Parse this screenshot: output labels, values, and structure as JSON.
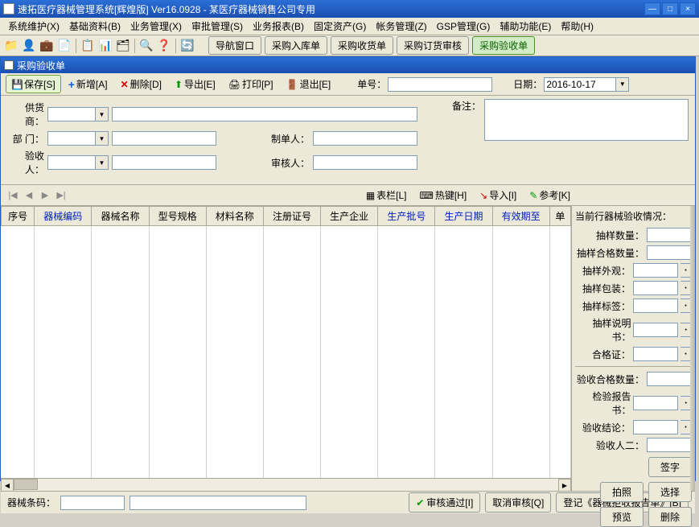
{
  "titlebar": {
    "text": "速拓医疗器械管理系统[辉煌版] Ver16.0928  -  某医疗器械销售公司专用"
  },
  "menubar": {
    "items": [
      "系统维护(X)",
      "基础资料(B)",
      "业务管理(X)",
      "审批管理(S)",
      "业务报表(B)",
      "固定资产(G)",
      "帐务管理(Z)",
      "GSP管理(G)",
      "辅助功能(E)",
      "帮助(H)"
    ]
  },
  "navbtns": {
    "items": [
      "导航窗口",
      "采购入库单",
      "采购收货单",
      "采购订货审核",
      "采购验收单"
    ]
  },
  "subwindow": {
    "title": "采购验收单"
  },
  "actions": {
    "save": "保存[S]",
    "add": "新增[A]",
    "delete": "删除[D]",
    "export": "导出[E]",
    "print": "打印[P]",
    "exit": "退出[E]",
    "billno_lbl": "单号：",
    "date_lbl": "日期：",
    "date_val": "2016-10-17"
  },
  "form": {
    "supplier_lbl": "供货商：",
    "dept_lbl": "部 门：",
    "receiver_lbl": "验收人：",
    "maker_lbl": "制单人：",
    "auditor_lbl": "审核人：",
    "remark_lbl": "备注："
  },
  "midbar": {
    "items": [
      "表栏[L]",
      "热键[H]",
      "导入[I]",
      "参考[K]"
    ]
  },
  "grid": {
    "headers": [
      {
        "t": "序号",
        "blue": false
      },
      {
        "t": "器械编码",
        "blue": true
      },
      {
        "t": "器械名称",
        "blue": false
      },
      {
        "t": "型号规格",
        "blue": false
      },
      {
        "t": "材料名称",
        "blue": false
      },
      {
        "t": "注册证号",
        "blue": false
      },
      {
        "t": "生产企业",
        "blue": false
      },
      {
        "t": "生产批号",
        "blue": true
      },
      {
        "t": "生产日期",
        "blue": true
      },
      {
        "t": "有效期至",
        "blue": true
      },
      {
        "t": "单",
        "blue": false
      }
    ]
  },
  "side": {
    "title": "当前行器械验收情况：",
    "rows1": [
      {
        "lbl": "抽样数量：",
        "dd": false
      },
      {
        "lbl": "抽样合格数量：",
        "dd": false
      },
      {
        "lbl": "抽样外观：",
        "dd": true
      },
      {
        "lbl": "抽样包装：",
        "dd": true
      },
      {
        "lbl": "抽样标签：",
        "dd": true
      },
      {
        "lbl": "抽样说明书：",
        "dd": true
      },
      {
        "lbl": "合格证：",
        "dd": true
      }
    ],
    "rows2": [
      {
        "lbl": "验收合格数量：",
        "dd": false
      },
      {
        "lbl": "检验报告书：",
        "dd": true
      },
      {
        "lbl": "验收结论：",
        "dd": true
      },
      {
        "lbl": "验收人二：",
        "dd": false
      }
    ],
    "sign": "签字",
    "photo": "拍照",
    "select": "选择",
    "preview": "预览",
    "del": "删除"
  },
  "bottom": {
    "barcode_lbl": "器械条码：",
    "audit_pass": "审核通过[I]",
    "audit_cancel": "取消审核[Q]",
    "register": "登记《器械拒收报告单》[B]"
  }
}
